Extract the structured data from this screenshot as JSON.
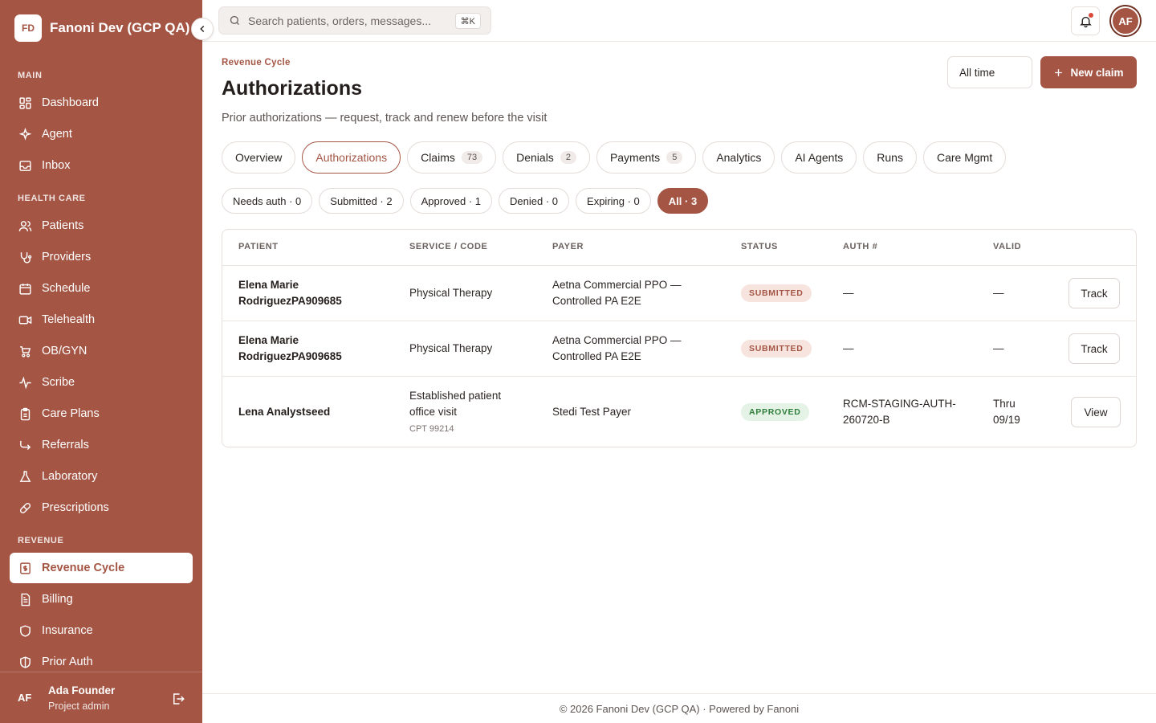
{
  "brand": {
    "initials": "FD",
    "name": "Fanoni Dev (GCP QA)"
  },
  "sidebar": {
    "sections": {
      "main": "MAIN",
      "health": "HEALTH CARE",
      "revenue": "REVENUE"
    },
    "items": [
      {
        "label": "Dashboard",
        "icon": "dashboard-icon"
      },
      {
        "label": "Agent",
        "icon": "sparkle-icon"
      },
      {
        "label": "Inbox",
        "icon": "inbox-icon"
      },
      {
        "label": "Patients",
        "icon": "users-icon"
      },
      {
        "label": "Providers",
        "icon": "stethoscope-icon"
      },
      {
        "label": "Schedule",
        "icon": "calendar-icon"
      },
      {
        "label": "Telehealth",
        "icon": "video-icon"
      },
      {
        "label": "OB/GYN",
        "icon": "stroller-icon"
      },
      {
        "label": "Scribe",
        "icon": "pulse-icon"
      },
      {
        "label": "Care Plans",
        "icon": "clipboard-icon"
      },
      {
        "label": "Referrals",
        "icon": "share-icon"
      },
      {
        "label": "Laboratory",
        "icon": "flask-icon"
      },
      {
        "label": "Prescriptions",
        "icon": "pill-icon"
      },
      {
        "label": "Revenue Cycle",
        "icon": "receipt-icon",
        "active": true
      },
      {
        "label": "Billing",
        "icon": "document-icon"
      },
      {
        "label": "Insurance",
        "icon": "shield-icon"
      },
      {
        "label": "Prior Auth",
        "icon": "shield-half-icon"
      }
    ],
    "footer": {
      "initials": "AF",
      "name": "Ada Founder",
      "role": "Project admin"
    }
  },
  "topbar": {
    "search_placeholder": "Search patients, orders, messages...",
    "shortcut": "⌘K",
    "avatar_initials": "AF"
  },
  "header": {
    "eyebrow": "Revenue Cycle",
    "title": "Authorizations",
    "subtitle": "Prior authorizations — request, track and renew before the visit",
    "range": "All time",
    "new_claim": "New claim"
  },
  "tabs": [
    {
      "label": "Overview"
    },
    {
      "label": "Authorizations",
      "active": true
    },
    {
      "label": "Claims",
      "badge": "73"
    },
    {
      "label": "Denials",
      "badge": "2"
    },
    {
      "label": "Payments",
      "badge": "5"
    },
    {
      "label": "Analytics"
    },
    {
      "label": "AI Agents"
    },
    {
      "label": "Runs"
    },
    {
      "label": "Care Mgmt"
    }
  ],
  "filters": [
    {
      "label": "Needs auth · 0"
    },
    {
      "label": "Submitted · 2"
    },
    {
      "label": "Approved · 1"
    },
    {
      "label": "Denied · 0"
    },
    {
      "label": "Expiring · 0"
    },
    {
      "label": "All · 3",
      "active": true
    }
  ],
  "table": {
    "headers": [
      "PATIENT",
      "SERVICE / CODE",
      "PAYER",
      "STATUS",
      "AUTH #",
      "VALID"
    ],
    "rows": [
      {
        "patient_line1": "Elena Marie",
        "patient_line2": "RodriguezPA909685",
        "service_line1": "Physical Therapy",
        "payer_line1": "Aetna Commercial PPO —",
        "payer_line2": "Controlled PA E2E",
        "status": "SUBMITTED",
        "auth": "—",
        "valid": "—",
        "action": "Track"
      },
      {
        "patient_line1": "Elena Marie",
        "patient_line2": "RodriguezPA909685",
        "service_line1": "Physical Therapy",
        "payer_line1": "Aetna Commercial PPO —",
        "payer_line2": "Controlled PA E2E",
        "status": "SUBMITTED",
        "auth": "—",
        "valid": "—",
        "action": "Track"
      },
      {
        "patient_line1": "Lena Analystseed",
        "service_line1": "Established patient",
        "service_line2": "office visit",
        "code": "CPT 99214",
        "payer_line1": "Stedi Test Payer",
        "status": "APPROVED",
        "auth_line1": "RCM-STAGING-AUTH-",
        "auth_line2": "260720-B",
        "valid_line1": "Thru",
        "valid_line2": "09/19",
        "action": "View"
      }
    ]
  },
  "footer": {
    "text": "© 2026 Fanoni Dev (GCP QA) · Powered by Fanoni"
  },
  "colors": {
    "brand": "#a45544",
    "approved": "#2f7d3b"
  }
}
